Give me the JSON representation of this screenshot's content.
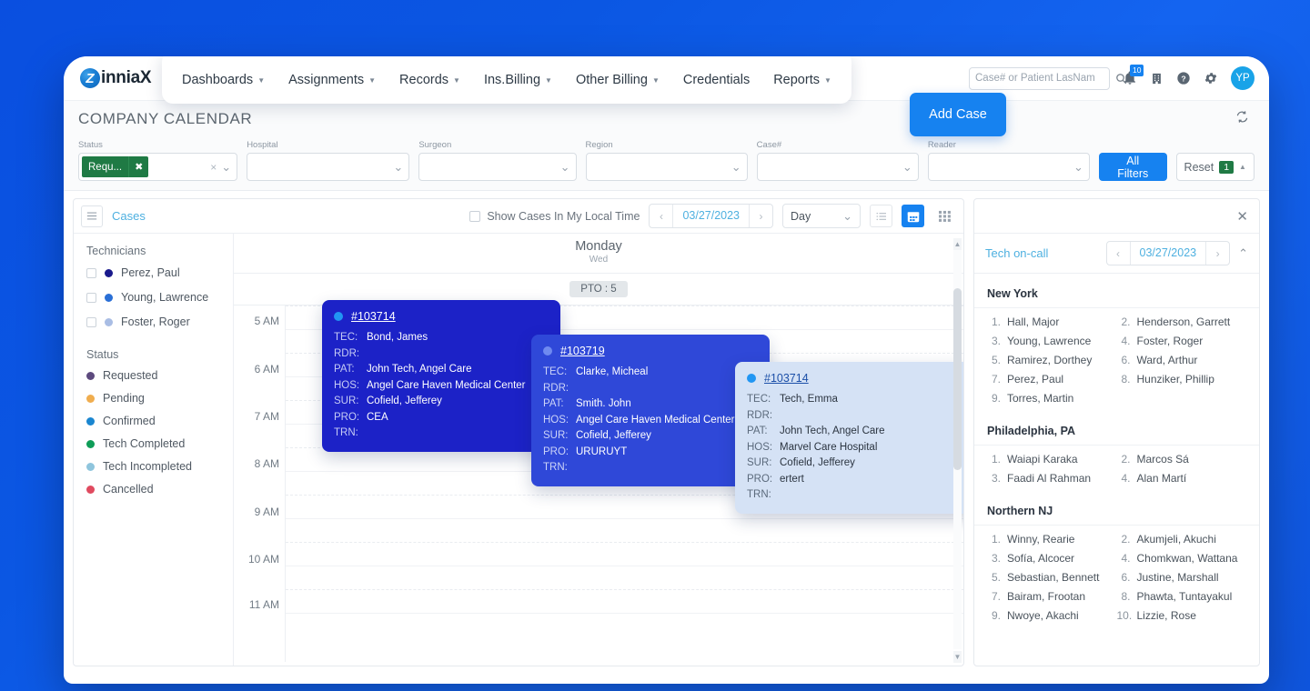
{
  "brand": {
    "logo_mark": "Z",
    "logo_text": "inniaX"
  },
  "nav": [
    {
      "label": "Dashboards",
      "has_caret": true
    },
    {
      "label": "Assignments",
      "has_caret": true
    },
    {
      "label": "Records",
      "has_caret": true
    },
    {
      "label": "Ins.Billing",
      "has_caret": true
    },
    {
      "label": "Other Billing",
      "has_caret": true
    },
    {
      "label": "Credentials",
      "has_caret": false
    },
    {
      "label": "Reports",
      "has_caret": true
    }
  ],
  "add_case_label": "Add Case",
  "search": {
    "placeholder": "Case# or Patient LasNam",
    "value": ""
  },
  "header_icons": {
    "notification_count": "10",
    "avatar_initials": "YP"
  },
  "page_title": "COMPANY CALENDAR",
  "filters": {
    "status": {
      "label": "Status",
      "chip": "Requ...",
      "chip_close": "✖"
    },
    "hospital": {
      "label": "Hospital",
      "value": ""
    },
    "surgeon": {
      "label": "Surgeon",
      "value": ""
    },
    "region": {
      "label": "Region",
      "value": ""
    },
    "case_number": {
      "label": "Case#",
      "value": ""
    },
    "reader": {
      "label": "Reader",
      "value": ""
    },
    "all_filters_label": "All Filters",
    "reset_label": "Reset",
    "reset_count": "1"
  },
  "toolbar": {
    "cases_label": "Cases",
    "local_time_label": "Show Cases In My Local Time",
    "date": "03/27/2023",
    "view": "Day"
  },
  "sidebar": {
    "technicians_header": "Technicians",
    "technicians": [
      {
        "name": "Perez, Paul",
        "color": "#1a1a8c"
      },
      {
        "name": "Young, Lawrence",
        "color": "#2a6fd6"
      },
      {
        "name": "Foster, Roger",
        "color": "#a9bde4"
      }
    ],
    "status_header": "Status",
    "statuses": [
      {
        "name": "Requested",
        "color": "#5d4a7e"
      },
      {
        "name": "Pending",
        "color": "#f0ad4e"
      },
      {
        "name": "Confirmed",
        "color": "#1a86d0"
      },
      {
        "name": "Tech Completed",
        "color": "#0f9d58"
      },
      {
        "name": "Tech Incompleted",
        "color": "#8fc5dd"
      },
      {
        "name": "Cancelled",
        "color": "#e04a5f"
      }
    ]
  },
  "calendar": {
    "day_name": "Monday",
    "day_sub": "Wed",
    "pto_badge": "PTO : 5",
    "time_labels": [
      "5 AM",
      "6 AM",
      "7 AM",
      "8 AM",
      "9 AM",
      "10 AM",
      "11 AM"
    ],
    "events": [
      {
        "id": "#103714",
        "keys": [
          "TEC:",
          "RDR:",
          "PAT:",
          "HOS:",
          "SUR:",
          "PRO:",
          "TRN:"
        ],
        "values": [
          "Bond, James",
          "",
          "John Tech, Angel Care",
          "Angel Care Haven Medical Center",
          "Cofield, Jefferey",
          "CEA",
          ""
        ]
      },
      {
        "id": "#103719",
        "keys": [
          "TEC:",
          "RDR:",
          "PAT:",
          "HOS:",
          "SUR:",
          "PRO:",
          "TRN:"
        ],
        "values": [
          "Clarke, Micheal",
          "",
          "Smith. John",
          "Angel Care Haven Medical Center",
          "Cofield, Jefferey",
          "URURUYT",
          ""
        ]
      },
      {
        "id": "#103714",
        "keys": [
          "TEC:",
          "RDR:",
          "PAT:",
          "HOS:",
          "SUR:",
          "PRO:",
          "TRN:"
        ],
        "values": [
          "Tech, Emma",
          "",
          "John Tech, Angel Care",
          "Marvel Care Hospital",
          "Cofield, Jefferey",
          "ertert",
          ""
        ]
      }
    ]
  },
  "tech_on_call": {
    "title": "Tech on-call",
    "date": "03/27/2023",
    "regions": [
      {
        "name": "New York",
        "people": [
          "Hall, Major",
          "Henderson, Garrett",
          "Young, Lawrence",
          "Foster, Roger",
          "Ramirez, Dorthey",
          "Ward, Arthur",
          "Perez, Paul",
          "Hunziker, Phillip",
          "Torres, Martin"
        ]
      },
      {
        "name": "Philadelphia, PA",
        "people": [
          "Waiapi Karaka",
          "Marcos Sá",
          "Faadi Al Rahman",
          "Alan Martí"
        ]
      },
      {
        "name": "Northern NJ",
        "people": [
          "Winny, Rearie",
          "Akumjeli, Akuchi",
          "Sofía, Alcocer",
          "Chomkwan, Wattana",
          "Sebastian, Bennett",
          "Justine, Marshall",
          "Bairam, Frootan",
          "Phawta, Tuntayakul",
          "Nwoye, Akachi",
          "Lizzie, Rose"
        ]
      }
    ]
  },
  "colors": {
    "brand_blue": "#1682f0",
    "accent_cyan": "#4eb0e0",
    "chip_green": "#1f7a44",
    "event_dark": "#1c22c7",
    "event_mid": "#2f48d8",
    "event_light": "#d5e2f5"
  }
}
